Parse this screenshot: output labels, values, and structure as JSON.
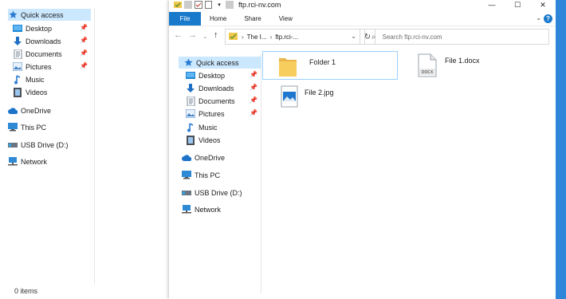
{
  "window": {
    "title": "ftp.rci-nv.com",
    "controls": [
      "minimize",
      "maximize",
      "close"
    ]
  },
  "ribbon": {
    "tabs": [
      "File",
      "Home",
      "Share",
      "View"
    ]
  },
  "address_bar": {
    "crumbs": [
      "The I...",
      "ftp.rci-..."
    ],
    "search_placeholder": "Search ftp.rci-nv.com"
  },
  "nav_pane": {
    "items": [
      {
        "label": "Quick access",
        "icon": "star-icon",
        "pinned": false,
        "selected": true
      },
      {
        "label": "Desktop",
        "icon": "desktop-folder-icon",
        "pinned": true
      },
      {
        "label": "Downloads",
        "icon": "download-arrow-icon",
        "pinned": true
      },
      {
        "label": "Documents",
        "icon": "documents-icon",
        "pinned": true
      },
      {
        "label": "Pictures",
        "icon": "pictures-icon",
        "pinned": true
      },
      {
        "label": "Music",
        "icon": "music-note-icon",
        "pinned": false
      },
      {
        "label": "Videos",
        "icon": "videos-icon",
        "pinned": false
      },
      {
        "label": "OneDrive",
        "icon": "cloud-icon",
        "pinned": false
      },
      {
        "label": "This PC",
        "icon": "computer-icon",
        "pinned": false
      },
      {
        "label": "USB Drive (D:)",
        "icon": "usb-drive-icon",
        "pinned": false
      },
      {
        "label": "Network",
        "icon": "network-icon",
        "pinned": false
      }
    ]
  },
  "files": [
    {
      "name": "Folder 1",
      "type": "folder",
      "icon": "folder-icon"
    },
    {
      "name": "File 1.docx",
      "type": "docx",
      "icon": "docx-file-icon",
      "badge": "DOCX"
    },
    {
      "name": "File 2.jpg",
      "type": "jpg",
      "icon": "image-file-icon"
    }
  ],
  "status_bar": {
    "item_count": "0 items"
  },
  "colors": {
    "accent": "#1979ca",
    "selection": "#cce8ff",
    "folder": "#f7cd5d",
    "desktop": "#1e6fc8"
  }
}
